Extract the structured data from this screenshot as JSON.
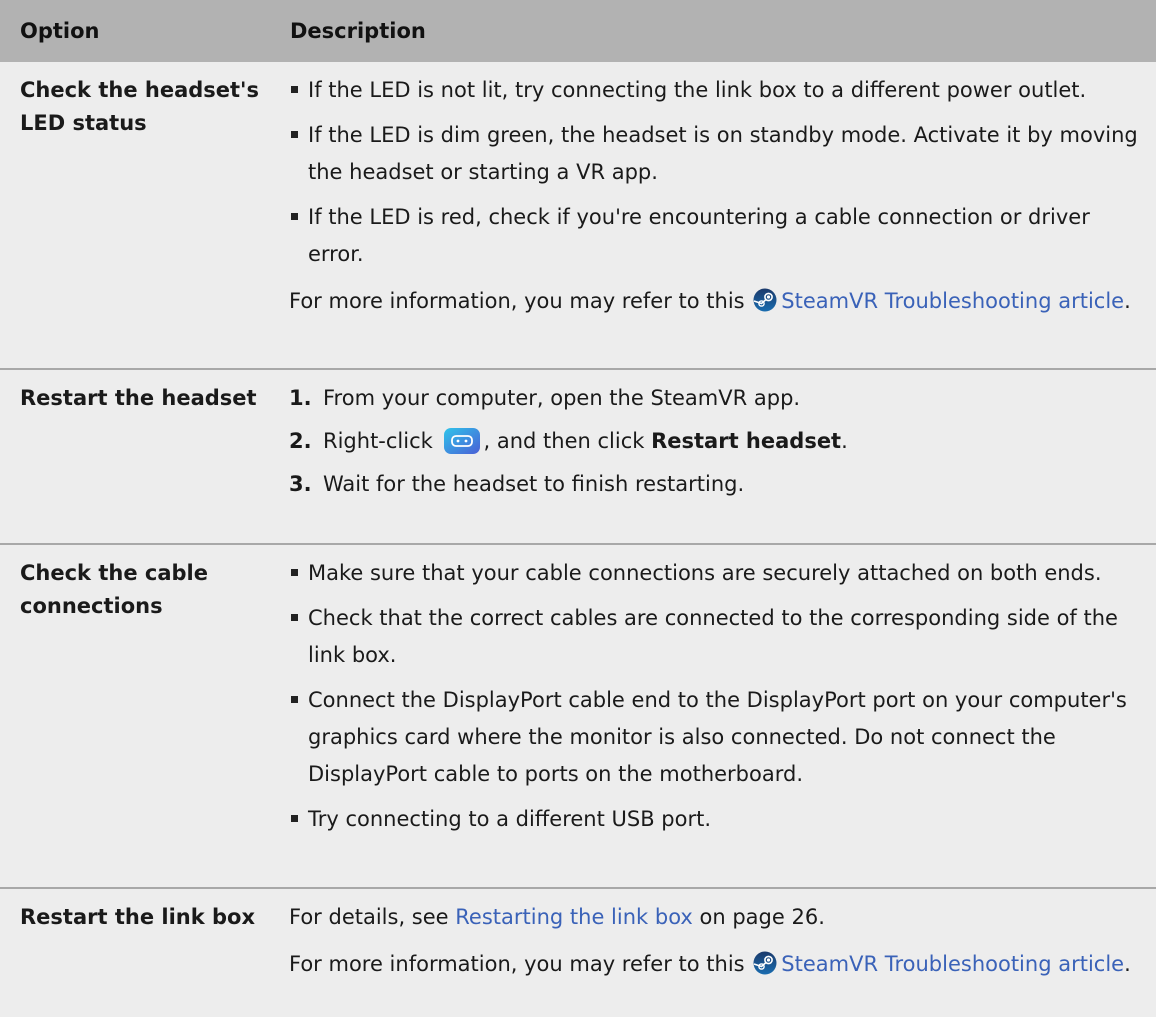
{
  "header": {
    "col1": "Option",
    "col2": "Description"
  },
  "rows": [
    {
      "option": "Check the headset's LED status",
      "bullets": [
        "If the LED is not lit, try connecting the link box to a different power outlet.",
        "If the LED is dim green, the headset is on standby mode. Activate it by moving the headset or starting a VR app.",
        "If the LED is red, check if you're encountering a cable connection or driver error."
      ],
      "more_info_prefix": "For more information, you may refer to this",
      "more_info_link": "SteamVR Troubleshooting article",
      "more_info_suffix": "."
    },
    {
      "option": "Restart the headset",
      "steps": [
        {
          "num": "1.",
          "text": "From your computer, open the SteamVR app."
        },
        {
          "num": "2.",
          "pre": "Right-click",
          "mid": ", and then click",
          "bold": "Restart headset",
          "post": "."
        },
        {
          "num": "3.",
          "text": "Wait for the headset to finish restarting."
        }
      ]
    },
    {
      "option": "Check the cable connections",
      "bullets": [
        "Make sure that your cable connections are securely attached on both ends.",
        "Check that the correct cables are connected to the corresponding side of the link box.",
        "Connect the DisplayPort cable end to the DisplayPort port on your computer's graphics card where the monitor is also connected. Do not connect the DisplayPort cable to ports on the motherboard.",
        "Try connecting to a different USB port."
      ]
    },
    {
      "option": "Restart the link box",
      "details_prefix": "For details, see",
      "details_link": "Restarting the link box",
      "details_suffix": "on page 26.",
      "more_info_prefix": "For more information, you may refer to this",
      "more_info_link": "SteamVR Troubleshooting article",
      "more_info_suffix": "."
    }
  ],
  "icons": {
    "steam": "steam-logo-icon",
    "headset_status": "headset-status-icon"
  },
  "colors": {
    "link": "#3a62b8",
    "header_bg": "#b2b2b2",
    "body_bg": "#ededed",
    "divider": "#a8a8a8"
  }
}
